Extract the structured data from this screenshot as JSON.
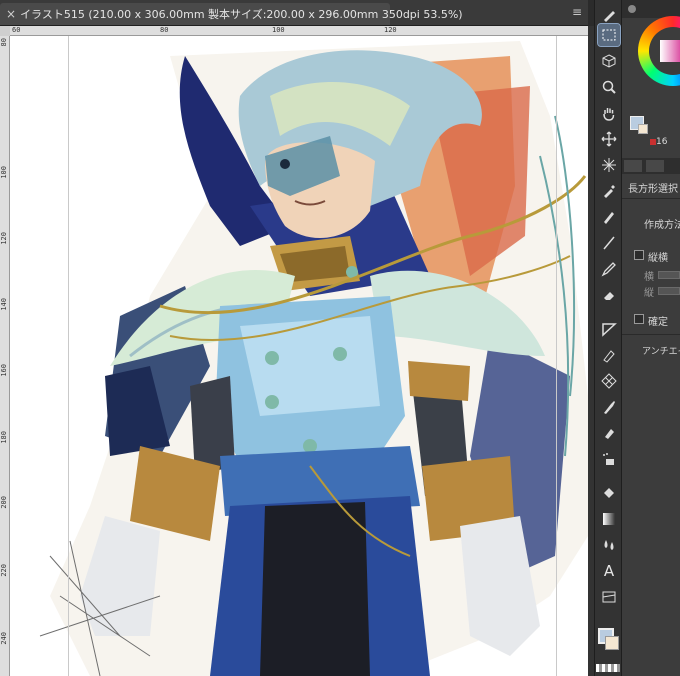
{
  "document": {
    "tab_close": "×",
    "tab_title": "イラスト515 (210.00 x 306.00mm 製本サイズ:200.00 x 296.00mm 350dpi 53.5%)",
    "tabbar_menu": "≡"
  },
  "ruler": {
    "top_labels": [
      "60",
      "80",
      "100",
      "120"
    ],
    "left_labels": [
      "80",
      "100",
      "120",
      "140",
      "160",
      "180",
      "200",
      "220",
      "240"
    ]
  },
  "tools": [
    {
      "name": "rect-select-tool",
      "icon": "dotted-rectangle",
      "active": true
    },
    {
      "name": "object-tool",
      "icon": "cube"
    },
    {
      "name": "zoom-tool",
      "icon": "magnifier"
    },
    {
      "name": "hand-tool",
      "icon": "hand"
    },
    {
      "name": "move-tool",
      "icon": "cross-arrows"
    },
    {
      "name": "auto-select-tool",
      "icon": "magic-wand"
    },
    {
      "name": "eyedropper-tool",
      "icon": "eyedropper"
    },
    {
      "name": "pen-tool",
      "icon": "pen-nib"
    },
    {
      "name": "line-tool",
      "icon": "slash"
    },
    {
      "name": "pencil-tool",
      "icon": "pencil"
    },
    {
      "name": "eraser-tool",
      "icon": "eraser"
    },
    {
      "name": "ruler-tool",
      "icon": "triangle-ruler"
    },
    {
      "name": "vector-tool",
      "icon": "vector-pen"
    },
    {
      "name": "pattern-tool",
      "icon": "diamond-grid"
    },
    {
      "name": "brush-tool",
      "icon": "brush"
    },
    {
      "name": "blend-tool",
      "icon": "blend"
    },
    {
      "name": "airbrush-tool",
      "icon": "airbrush"
    },
    {
      "name": "fill-tool",
      "icon": "bucket"
    },
    {
      "name": "gradient-tool",
      "icon": "gradient-square"
    },
    {
      "name": "blur-tool",
      "icon": "droplets"
    },
    {
      "name": "text-tool",
      "icon": "letter-a",
      "glyph": "A"
    },
    {
      "name": "frame-tool",
      "icon": "frame"
    }
  ],
  "panel": {
    "brush_size": "16",
    "tool_name": "長方形選択",
    "create_method_label": "作成方法",
    "aspect_label": "縦横",
    "width_label": "横",
    "height_label": "縦",
    "confirm_label": "確定",
    "antialias_label": "アンチエイ"
  },
  "colors": {
    "main": "#b9cce0",
    "sub": "#f4e7d2",
    "active_tool": "#5a6b80"
  }
}
